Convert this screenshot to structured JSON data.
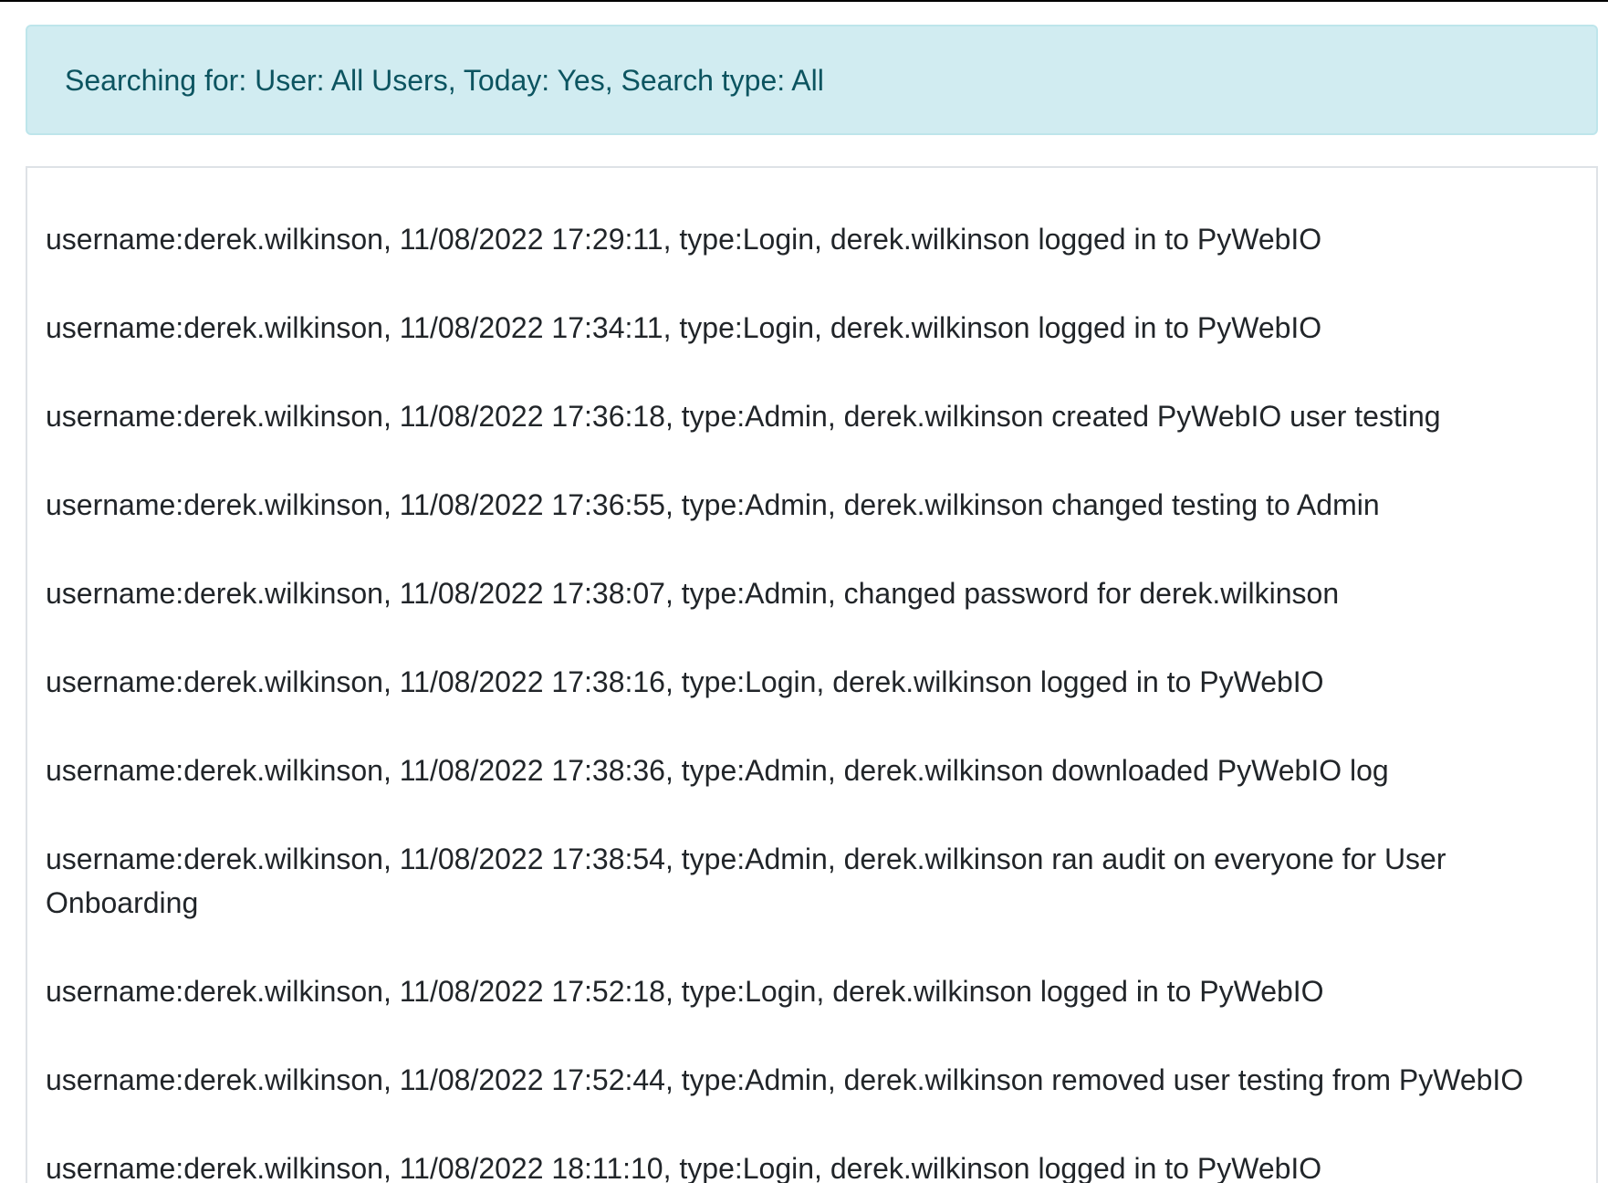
{
  "search_summary": "Searching for: User: All Users, Today: Yes, Search type: All",
  "log_entries": [
    "username:derek.wilkinson, 11/08/2022 17:29:11, type:Login, derek.wilkinson logged in to PyWebIO",
    "username:derek.wilkinson, 11/08/2022 17:34:11, type:Login, derek.wilkinson logged in to PyWebIO",
    "username:derek.wilkinson, 11/08/2022 17:36:18, type:Admin, derek.wilkinson created PyWebIO user testing",
    "username:derek.wilkinson, 11/08/2022 17:36:55, type:Admin, derek.wilkinson changed testing to Admin",
    "username:derek.wilkinson, 11/08/2022 17:38:07, type:Admin, changed password for derek.wilkinson",
    "username:derek.wilkinson, 11/08/2022 17:38:16, type:Login, derek.wilkinson logged in to PyWebIO",
    "username:derek.wilkinson, 11/08/2022 17:38:36, type:Admin, derek.wilkinson downloaded PyWebIO log",
    "username:derek.wilkinson, 11/08/2022 17:38:54, type:Admin, derek.wilkinson ran audit on everyone for User Onboarding",
    "username:derek.wilkinson, 11/08/2022 17:52:18, type:Login, derek.wilkinson logged in to PyWebIO",
    "username:derek.wilkinson, 11/08/2022 17:52:44, type:Admin, derek.wilkinson removed user testing from PyWebIO",
    "username:derek.wilkinson, 11/08/2022 18:11:10, type:Login, derek.wilkinson logged in to PyWebIO"
  ],
  "colors": {
    "alert_background": "#d1ecf1",
    "alert_border": "#bee5eb",
    "alert_text": "#0c5460",
    "log_text": "#212529",
    "log_border": "#dee2e6"
  }
}
